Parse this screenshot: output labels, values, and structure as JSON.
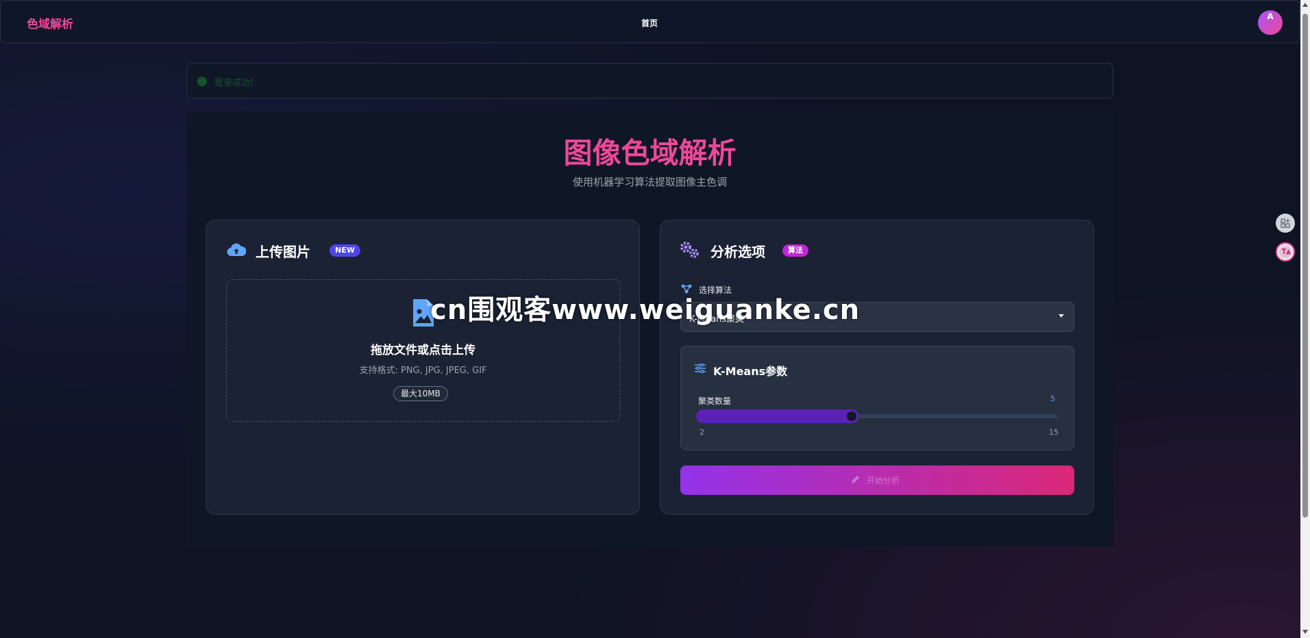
{
  "app": {
    "brand": "色域解析",
    "nav_home": "首页",
    "avatar_initial": "A"
  },
  "alert": {
    "text": "登录成功!"
  },
  "hero": {
    "title": "图像色域解析",
    "subtitle": "使用机器学习算法提取图像主色调"
  },
  "upload_card": {
    "title": "上传图片",
    "badge": "NEW",
    "drop_title": "拖放文件或点击上传",
    "formats": "支持格式: PNG, JPG, JPEG, GIF",
    "max_size": "最大10MB"
  },
  "options_card": {
    "title": "分析选项",
    "badge": "算法",
    "algorithm_label": "选择算法",
    "algorithm_value": "K-Means聚类",
    "params_title": "K-Means参数",
    "cluster_label": "聚类数量",
    "cluster_value": "5",
    "slider_min": "2",
    "slider_max": "15",
    "slider": {
      "value": 5,
      "min": 2,
      "max": 15
    },
    "analyze_label": "开始分析"
  },
  "watermark": "cn围观客www.weiguanke.cn",
  "colors": {
    "accent_pink": "#ec4899",
    "accent_purple": "#9333ea",
    "slider": "#5b21b6",
    "info_blue": "#60a5fa"
  },
  "icons": [
    "cloud-upload-icon",
    "gears-icon",
    "file-image-icon",
    "share-nodes-icon",
    "sliders-icon",
    "pencil-icon",
    "check-circle-icon",
    "apps-icon",
    "translate-icon"
  ]
}
